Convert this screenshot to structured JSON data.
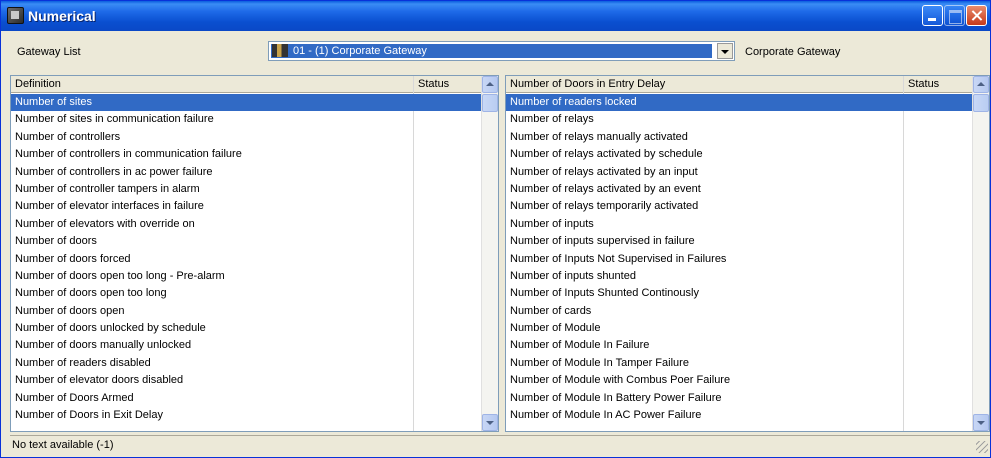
{
  "window": {
    "title": "Numerical"
  },
  "gateway": {
    "label": "Gateway List",
    "selected": "01 - (1)  Corporate Gateway",
    "name": "Corporate Gateway"
  },
  "left_list": {
    "columns": [
      "Definition",
      "Status"
    ],
    "selected_index": 0,
    "rows": [
      "Number of sites",
      "Number of sites in communication failure",
      "Number of controllers",
      "Number of controllers in communication failure",
      "Number of controllers in ac power failure",
      "Number of controller tampers in alarm",
      "Number of elevator interfaces in failure",
      "Number of elevators with override on",
      "Number of doors",
      "Number of doors forced",
      "Number of doors open too long - Pre-alarm",
      "Number of doors open too long",
      "Number of doors open",
      "Number of doors unlocked by schedule",
      "Number of doors manually unlocked",
      "Number of readers disabled",
      "Number of elevator doors disabled",
      "Number of Doors Armed",
      "Number of Doors in Exit Delay"
    ]
  },
  "right_list": {
    "columns": [
      "Number of Doors in Entry Delay",
      "Status"
    ],
    "selected_index": 0,
    "rows": [
      "Number of readers locked",
      "Number of relays",
      "Number of relays manually activated",
      "Number of relays activated by schedule",
      "Number of relays activated by an input",
      "Number of relays activated by an event",
      "Number of relays temporarily activated",
      "Number of inputs",
      "Number of inputs supervised in failure",
      "Number of Inputs Not Supervised in Failures",
      "Number of inputs shunted",
      "Number of Inputs Shunted Continously",
      "Number of cards",
      "Number of Module",
      "Number of Module In Failure",
      "Number of Module In Tamper Failure",
      "Number of Module with Combus Poer Failure",
      "Number of Module In Battery Power Failure",
      "Number of Module In AC Power Failure"
    ]
  },
  "status_bar": {
    "text": "No text available (-1)"
  }
}
